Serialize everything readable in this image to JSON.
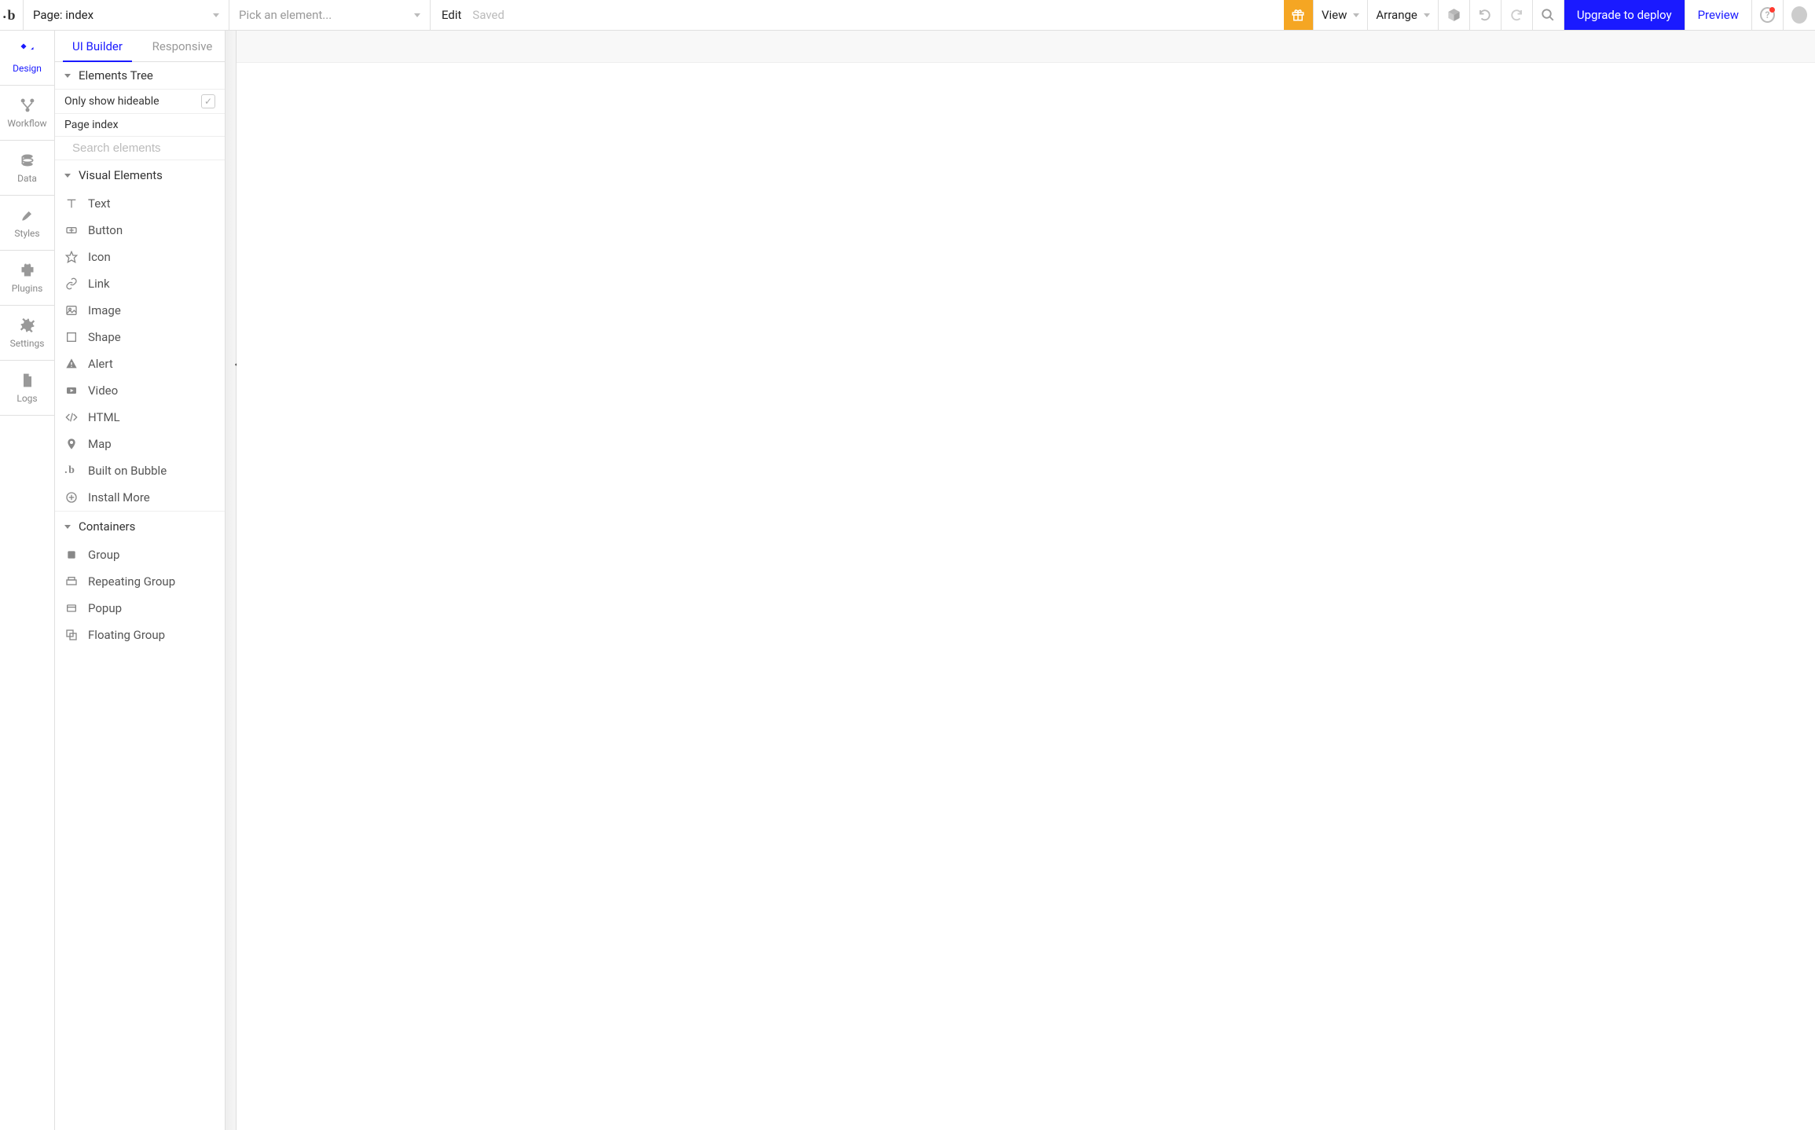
{
  "topbar": {
    "page_label": "Page: index",
    "element_picker_placeholder": "Pick an element...",
    "edit_label": "Edit",
    "saved_label": "Saved",
    "view_label": "View",
    "arrange_label": "Arrange",
    "upgrade_label": "Upgrade to deploy",
    "preview_label": "Preview"
  },
  "leftrail": {
    "items": [
      {
        "label": "Design",
        "icon": "design"
      },
      {
        "label": "Workflow",
        "icon": "workflow"
      },
      {
        "label": "Data",
        "icon": "data"
      },
      {
        "label": "Styles",
        "icon": "styles"
      },
      {
        "label": "Plugins",
        "icon": "plugins"
      },
      {
        "label": "Settings",
        "icon": "settings"
      },
      {
        "label": "Logs",
        "icon": "logs"
      }
    ]
  },
  "sidebar": {
    "tabs": {
      "ui_builder": "UI Builder",
      "responsive": "Responsive"
    },
    "elements_tree_label": "Elements Tree",
    "only_hideable_label": "Only show hideable",
    "page_label": "Page index",
    "search_placeholder": "Search elements",
    "visual_elements_label": "Visual Elements",
    "visual_elements": [
      {
        "label": "Text",
        "icon": "text"
      },
      {
        "label": "Button",
        "icon": "button"
      },
      {
        "label": "Icon",
        "icon": "star"
      },
      {
        "label": "Link",
        "icon": "link"
      },
      {
        "label": "Image",
        "icon": "image"
      },
      {
        "label": "Shape",
        "icon": "shape"
      },
      {
        "label": "Alert",
        "icon": "alert"
      },
      {
        "label": "Video",
        "icon": "video"
      },
      {
        "label": "HTML",
        "icon": "html"
      },
      {
        "label": "Map",
        "icon": "map"
      },
      {
        "label": "Built on Bubble",
        "icon": "bubble"
      },
      {
        "label": "Install More",
        "icon": "plus"
      }
    ],
    "containers_label": "Containers",
    "containers": [
      {
        "label": "Group",
        "icon": "group"
      },
      {
        "label": "Repeating Group",
        "icon": "repeating"
      },
      {
        "label": "Popup",
        "icon": "popup"
      },
      {
        "label": "Floating Group",
        "icon": "floating"
      }
    ]
  }
}
